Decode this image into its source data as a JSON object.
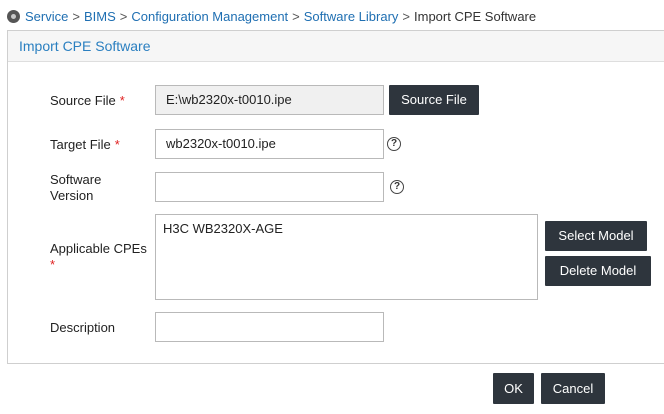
{
  "breadcrumb": {
    "items": [
      "Service",
      "BIMS",
      "Configuration Management",
      "Software Library"
    ],
    "separator": ">",
    "current": "Import CPE Software"
  },
  "panel": {
    "title": "Import CPE Software"
  },
  "form": {
    "required_mark": "*",
    "source_file": {
      "label": "Source File",
      "value": "E:\\wb2320x-t0010.ipe",
      "button": "Source File"
    },
    "target_file": {
      "label": "Target File",
      "value": "wb2320x-t0010.ipe"
    },
    "software_version": {
      "label_line1": "Software",
      "label_line2": "Version",
      "value": ""
    },
    "applicable_cpes": {
      "label": "Applicable CPEs",
      "items": [
        "H3C WB2320X-AGE"
      ],
      "select_button": "Select Model",
      "delete_button": "Delete Model"
    },
    "description": {
      "label": "Description",
      "value": ""
    },
    "help_glyph": "?"
  },
  "actions": {
    "ok": "OK",
    "cancel": "Cancel"
  },
  "colors": {
    "link": "#1f6fb2",
    "title": "#2a7fc0",
    "button_bg": "#2e353d",
    "required": "#e02020"
  }
}
